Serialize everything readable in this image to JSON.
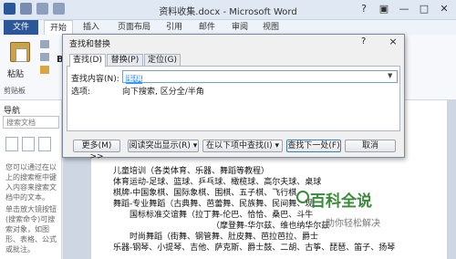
{
  "window": {
    "title": "资料收集.docx - Microsoft Word"
  },
  "titlebar": {
    "controls": [
      "?",
      "▣",
      "—",
      "□",
      "✕"
    ]
  },
  "ribbon": {
    "tabs": [
      "文件",
      "开始",
      "插入",
      "页面布局",
      "引用",
      "邮件",
      "审阅",
      "视图"
    ],
    "paste_label": "粘贴",
    "clipboard_group": "剪贴板",
    "bold_hint": "B"
  },
  "nav": {
    "title": "导航",
    "search_placeholder": "搜索文档",
    "text1": "您可以通过在以上的搜索框中键入内容来搜索文档中的文本。",
    "text2": "单击放大镜按钮(搜索命令)可搜索对象，如图形、表格、公式或批注。"
  },
  "document": {
    "lines": [
      "儿童培训（各类体育、乐器、舞蹈等教程）",
      "体育运动-足球、篮球、乒乓球、橄榄球、高尔夫球、桌球",
      "棋牌-中国象棋、国际象棋、围棋、五子棋、飞行棋",
      "舞蹈-专业舞蹈（古典舞、芭蕾舞、民族舞、民间舞、现",
      "国标标准交谊舞（拉丁舞-伦巴、恰恰、桑巴、斗牛",
      "（摩登舞-华尔兹、维也纳华尔兹",
      "时尚舞蹈（街舞、钢管舞、肚皮舞、芭拉芭拉、爵士",
      "乐器-钢琴、小提琴、吉他、萨克斯、爵士鼓、二胡、古筝、琵琶、笛子、扬琴"
    ]
  },
  "watermark": {
    "title": "百科全说",
    "subtitle": "助你轻松解决"
  },
  "dialog": {
    "title": "查找和替换",
    "help": "?",
    "close": "×",
    "tabs": [
      "查找(D)",
      "替换(P)",
      "定位(G)"
    ],
    "find_label": "查找内容(N):",
    "find_value": "围棋",
    "options_label": "选项:",
    "options_value": "向下搜索, 区分全/半角",
    "buttons": {
      "more": "更多(M) >>",
      "reading_highlight": "阅读突出显示(R) ▾",
      "find_in": "在以下项中查找(I) ▾",
      "find_next": "查找下一处(F)",
      "cancel": "取消"
    }
  },
  "colors": {
    "file_tab": "#2b579a",
    "watermark": "#3a8a3a",
    "selection": "#3399ff"
  }
}
